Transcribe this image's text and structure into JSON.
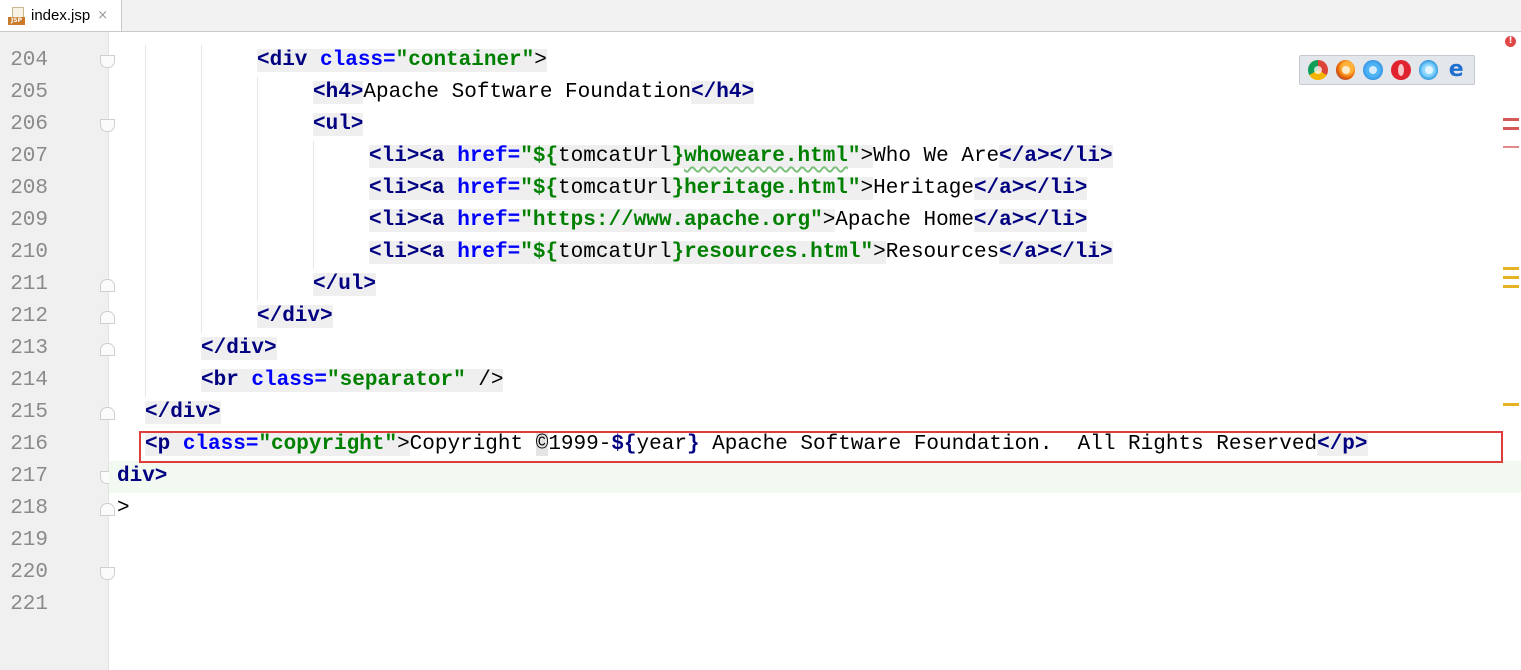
{
  "tab": {
    "file_icon_label": "JSP",
    "name": "index.jsp",
    "close": "×"
  },
  "gutter": {
    "line_numbers": [
      "204",
      "205",
      "206",
      "207",
      "208",
      "209",
      "210",
      "211",
      "212",
      "213",
      "214",
      "215",
      "216",
      "217",
      "218",
      "219",
      "220",
      "221"
    ]
  },
  "code": {
    "l204": {
      "open": "<div ",
      "attr": "class=",
      "val": "\"container\"",
      "close": ">"
    },
    "l205": {
      "open": "<h4>",
      "text": "Apache Software Foundation",
      "end": "</h4>"
    },
    "l206": {
      "open": "<ul>"
    },
    "l207": {
      "a": "<li><a ",
      "attr": "href=",
      "q1": "\"${",
      "var": "tomcatUrl",
      "q2": "}",
      "path": "whoweare.html",
      "q3": "\"",
      "gt": ">",
      "text": "Who We Are",
      "end": "</a></li>"
    },
    "l208": {
      "a": "<li><a ",
      "attr": "href=",
      "q1": "\"${",
      "var": "tomcatUrl",
      "q2": "}",
      "path": "heritage.html",
      "q3": "\"",
      "gt": ">",
      "text": "Heritage",
      "end": "</a></li>"
    },
    "l209": {
      "a": "<li><a ",
      "attr": "href=",
      "url": "\"https://www.apache.org\"",
      "gt": ">",
      "text": "Apache Home",
      "end": "</a></li>"
    },
    "l210": {
      "a": "<li><a ",
      "attr": "href=",
      "q1": "\"${",
      "var": "tomcatUrl",
      "q2": "}",
      "path": "resources.html",
      "q3": "\"",
      "gt": ">",
      "text": "Resources",
      "end": "</a></li>"
    },
    "l211": {
      "close": "</ul>"
    },
    "l212": {
      "close": "</div>"
    },
    "l213": {
      "close": "</div>"
    },
    "l214": {
      "open": "<br ",
      "attr": "class=",
      "val": "\"separator\"",
      "end": " />"
    },
    "l215": {
      "close": "</div>"
    },
    "l216": {
      "open": "<p ",
      "attr": "class=",
      "val": "\"copyright\"",
      "gt": ">",
      "t1": "Copyright ",
      "sym": "©",
      "t2": "1999-",
      "expr_open": "${",
      "expr": "year",
      "expr_close": "}",
      "t3": " Apache Software Foundation.  All Rights Reserved",
      "end": "</p>"
    },
    "l217": {
      "text": "div>"
    },
    "l218": {
      "text": ">"
    }
  },
  "browsers": [
    "chrome-icon",
    "firefox-icon",
    "safari-icon",
    "opera-icon",
    "ie-icon",
    "edge-icon"
  ],
  "edge_glyph": "e",
  "error_mark": "!",
  "colors": {
    "tag": "#000080",
    "attr": "#0000ff",
    "string": "#008000",
    "highlight": "#e03c3c"
  }
}
